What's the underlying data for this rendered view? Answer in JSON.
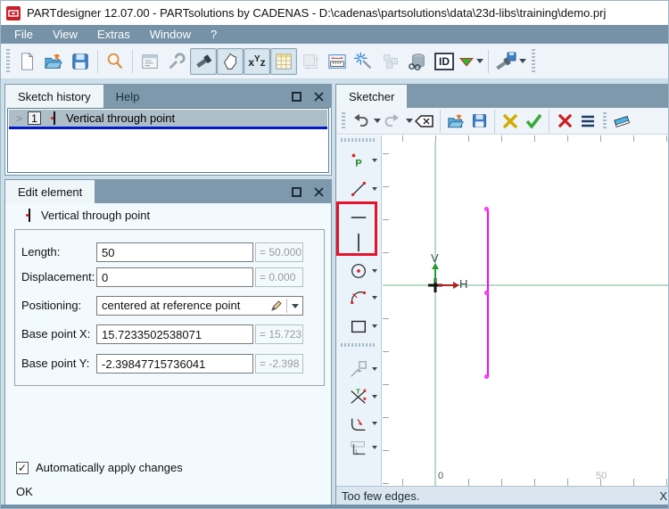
{
  "window": {
    "title": "PARTdesigner 12.07.00 - PARTsolutions by CADENAS - D:\\cadenas\\partsolutions\\data\\23d-libs\\training\\demo.prj"
  },
  "menu": {
    "items": [
      "File",
      "View",
      "Extras",
      "Window",
      "?"
    ]
  },
  "main_toolbar": {
    "icons": [
      "new-document",
      "open-project",
      "save",
      "zoom-search",
      "window-list",
      "wrench-settings",
      "view-3d-bolt",
      "view-sketch",
      "view-variables",
      "view-table",
      "box-dimension",
      "measure-ruler",
      "magic-wand",
      "blocks-3d",
      "cylinder-view",
      "id-display",
      "export-dropdown",
      "screw-save"
    ],
    "pressed_icons": [
      "view-3d-bolt",
      "view-sketch",
      "view-variables",
      "view-table"
    ]
  },
  "sketch_history": {
    "tabs": [
      "Sketch history",
      "Help"
    ],
    "active_tab": "Sketch history",
    "row": {
      "expander": ">",
      "index": "1",
      "label": "Vertical through point"
    }
  },
  "edit_element": {
    "title": "Edit element",
    "element_label": "Vertical through point",
    "fields": [
      {
        "label": "Length:",
        "value": "50",
        "computed": "= 50.000"
      },
      {
        "label": "Displacement:",
        "value": "0",
        "computed": "= 0.000"
      },
      {
        "label": "Positioning:",
        "value": "centered at reference point",
        "computed": ""
      },
      {
        "label": "Base point X:",
        "value": "15.7233502538071",
        "computed": "= 15.723"
      },
      {
        "label": "Base point Y:",
        "value": "-2.39847715736041",
        "computed": "= -2.398"
      }
    ],
    "checkbox": {
      "label": "Automatically apply changes",
      "checked": true,
      "glyph": "✓"
    },
    "ok_label": "OK"
  },
  "sketcher": {
    "tab": "Sketcher",
    "toolbar_icons": [
      "undo",
      "undo-dropdown",
      "redo",
      "redo-dropdown",
      "backspace-delete",
      "open-sketch",
      "save-sketch",
      "discard-changes",
      "apply-changes",
      "delete-element",
      "menu",
      "eraser"
    ],
    "palette_tools": [
      "point",
      "line",
      "horizontal-line",
      "vertical-line",
      "circle",
      "arc",
      "rectangle",
      "projection",
      "trim",
      "fillet",
      "profile"
    ],
    "highlight": {
      "tools": [
        "horizontal-line",
        "vertical-line"
      ],
      "color": "#e8112d"
    },
    "axes": {
      "h_label": "H",
      "v_label": "V"
    },
    "ruler": {
      "zero": "0",
      "fifty": "50"
    },
    "status": "Too few edges.",
    "status_right": "X"
  },
  "colors": {
    "menu_bar": "#7692a7",
    "panel_header": "#7e99ab",
    "selection_line": "#0018d0",
    "sketch_line": "#ff00ff",
    "sketch_point": "#ffd24a",
    "axis_green": "#b7dcc3",
    "highlight_red": "#e8112d",
    "status_bg": "#d9e6ef"
  }
}
